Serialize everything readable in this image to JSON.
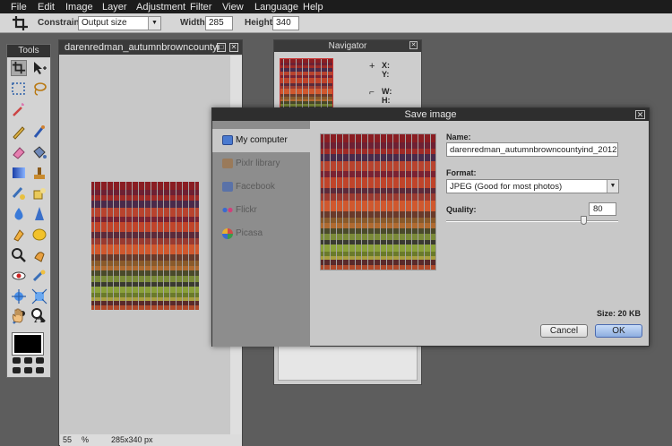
{
  "menu": [
    "File",
    "Edit",
    "Image",
    "Layer",
    "Adjustment",
    "Filter",
    "View",
    "Language",
    "Help"
  ],
  "options": {
    "constraint_label": "Constraint:",
    "constraint_value": "Output size",
    "width_label": "Width:",
    "width_value": "285",
    "height_label": "Height:",
    "height_value": "340"
  },
  "tools": {
    "title": "Tools"
  },
  "document": {
    "title": "darenredman_autumnbrowncountyi",
    "zoom": "55",
    "zoom_unit": "%",
    "size": "285x340 px"
  },
  "navigator": {
    "title": "Navigator",
    "x_label": "X:",
    "y_label": "Y:",
    "w_label": "W:",
    "h_label": "H:"
  },
  "save_dialog": {
    "title": "Save image",
    "destinations": [
      "My computer",
      "Pixlr library",
      "Facebook",
      "Flickr",
      "Picasa"
    ],
    "name_label": "Name:",
    "name_value": "darenredman_autumnbrowncountyind_2012",
    "format_label": "Format:",
    "format_value": "JPEG (Good for most photos)",
    "quality_label": "Quality:",
    "quality_value": "80",
    "quality_fraction": 0.8,
    "size_text": "Size: 20 KB",
    "cancel_label": "Cancel",
    "ok_label": "OK"
  },
  "colors": {
    "accent_ok": "#9ab8e6",
    "menubar": "#1c1c1c",
    "foreground": "#000000"
  },
  "icons": {
    "crop": "crop-icon",
    "move": "move-icon",
    "marquee": "marquee-icon",
    "lasso": "lasso-icon",
    "wand": "wand-icon",
    "pencil": "pencil-icon",
    "brush": "brush-icon",
    "eraser": "eraser-icon",
    "bucket": "paint-bucket-icon",
    "gradient": "gradient-icon",
    "stamp": "clone-stamp-icon",
    "drop": "drop-icon",
    "sharpen": "sharpen-icon",
    "text": "text-icon",
    "hand": "hand-icon",
    "zoom": "zoom-icon"
  }
}
